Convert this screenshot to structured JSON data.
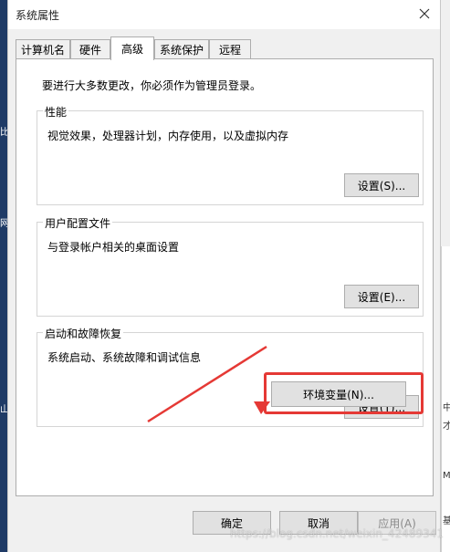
{
  "window": {
    "title": "系统属性"
  },
  "tabs": [
    {
      "label": "计算机名"
    },
    {
      "label": "硬件"
    },
    {
      "label": "高级",
      "active": true
    },
    {
      "label": "系统保护"
    },
    {
      "label": "远程"
    }
  ],
  "notice": "要进行大多数更改，你必须作为管理员登录。",
  "groups": {
    "performance": {
      "title": "性能",
      "desc": "视觉效果，处理器计划，内存使用，以及虚拟内存",
      "button": "设置(S)..."
    },
    "profiles": {
      "title": "用户配置文件",
      "desc": "与登录帐户相关的桌面设置",
      "button": "设置(E)..."
    },
    "startup": {
      "title": "启动和故障恢复",
      "desc": "系统启动、系统故障和调试信息",
      "button": "设置(T)..."
    }
  },
  "env_button": "环境变量(N)...",
  "footer": {
    "ok": "确定",
    "cancel": "取消",
    "apply": "应用(A)"
  },
  "watermark": "https://blog.csdn.net/weixin_42489341",
  "desktop": {
    "left_glyphs": [
      "比",
      "网",
      "山"
    ],
    "right_glyphs": [
      "中",
      "才",
      "M",
      "基"
    ]
  },
  "colors": {
    "highlight": "#e53935",
    "arrow": "#e53935"
  }
}
